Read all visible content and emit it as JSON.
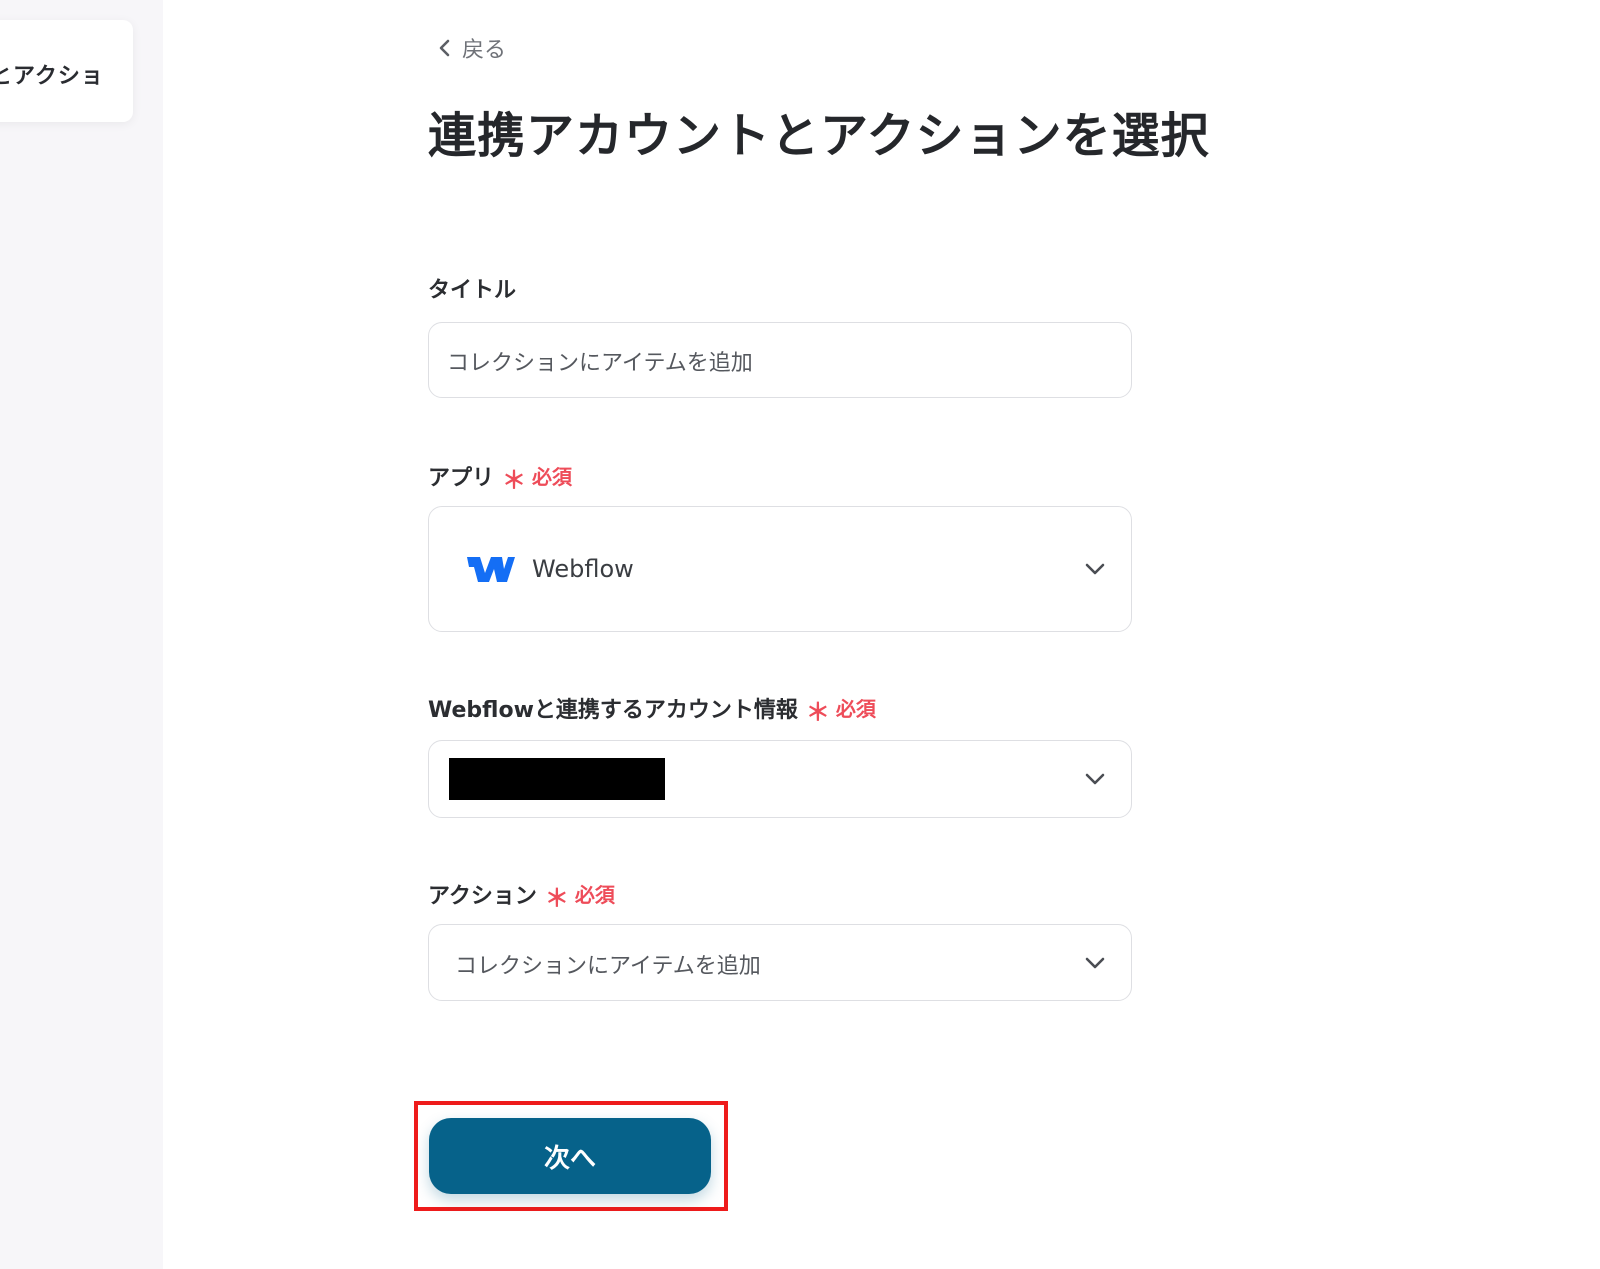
{
  "sidebar": {
    "card_text": "とアクショ"
  },
  "header": {
    "back_label": "戻る",
    "title": "連携アカウントとアクションを選択"
  },
  "form": {
    "title_field": {
      "label": "タイトル",
      "value": "コレクションにアイテムを追加"
    },
    "app_field": {
      "label": "アプリ",
      "required_mark": "＊",
      "required_text": "必須",
      "value": "Webflow",
      "icon": "webflow-logo-icon",
      "icon_color": "#146ef5"
    },
    "account_field": {
      "label": "Webflowと連携するアカウント情報",
      "required_mark": "＊",
      "required_text": "必須",
      "value_redacted": true
    },
    "action_field": {
      "label": "アクション",
      "required_mark": "＊",
      "required_text": "必須",
      "value": "コレクションにアイテムを追加"
    }
  },
  "footer": {
    "next_label": "次へ",
    "next_color": "#06628a",
    "highlight_color": "#ee1b1b"
  }
}
